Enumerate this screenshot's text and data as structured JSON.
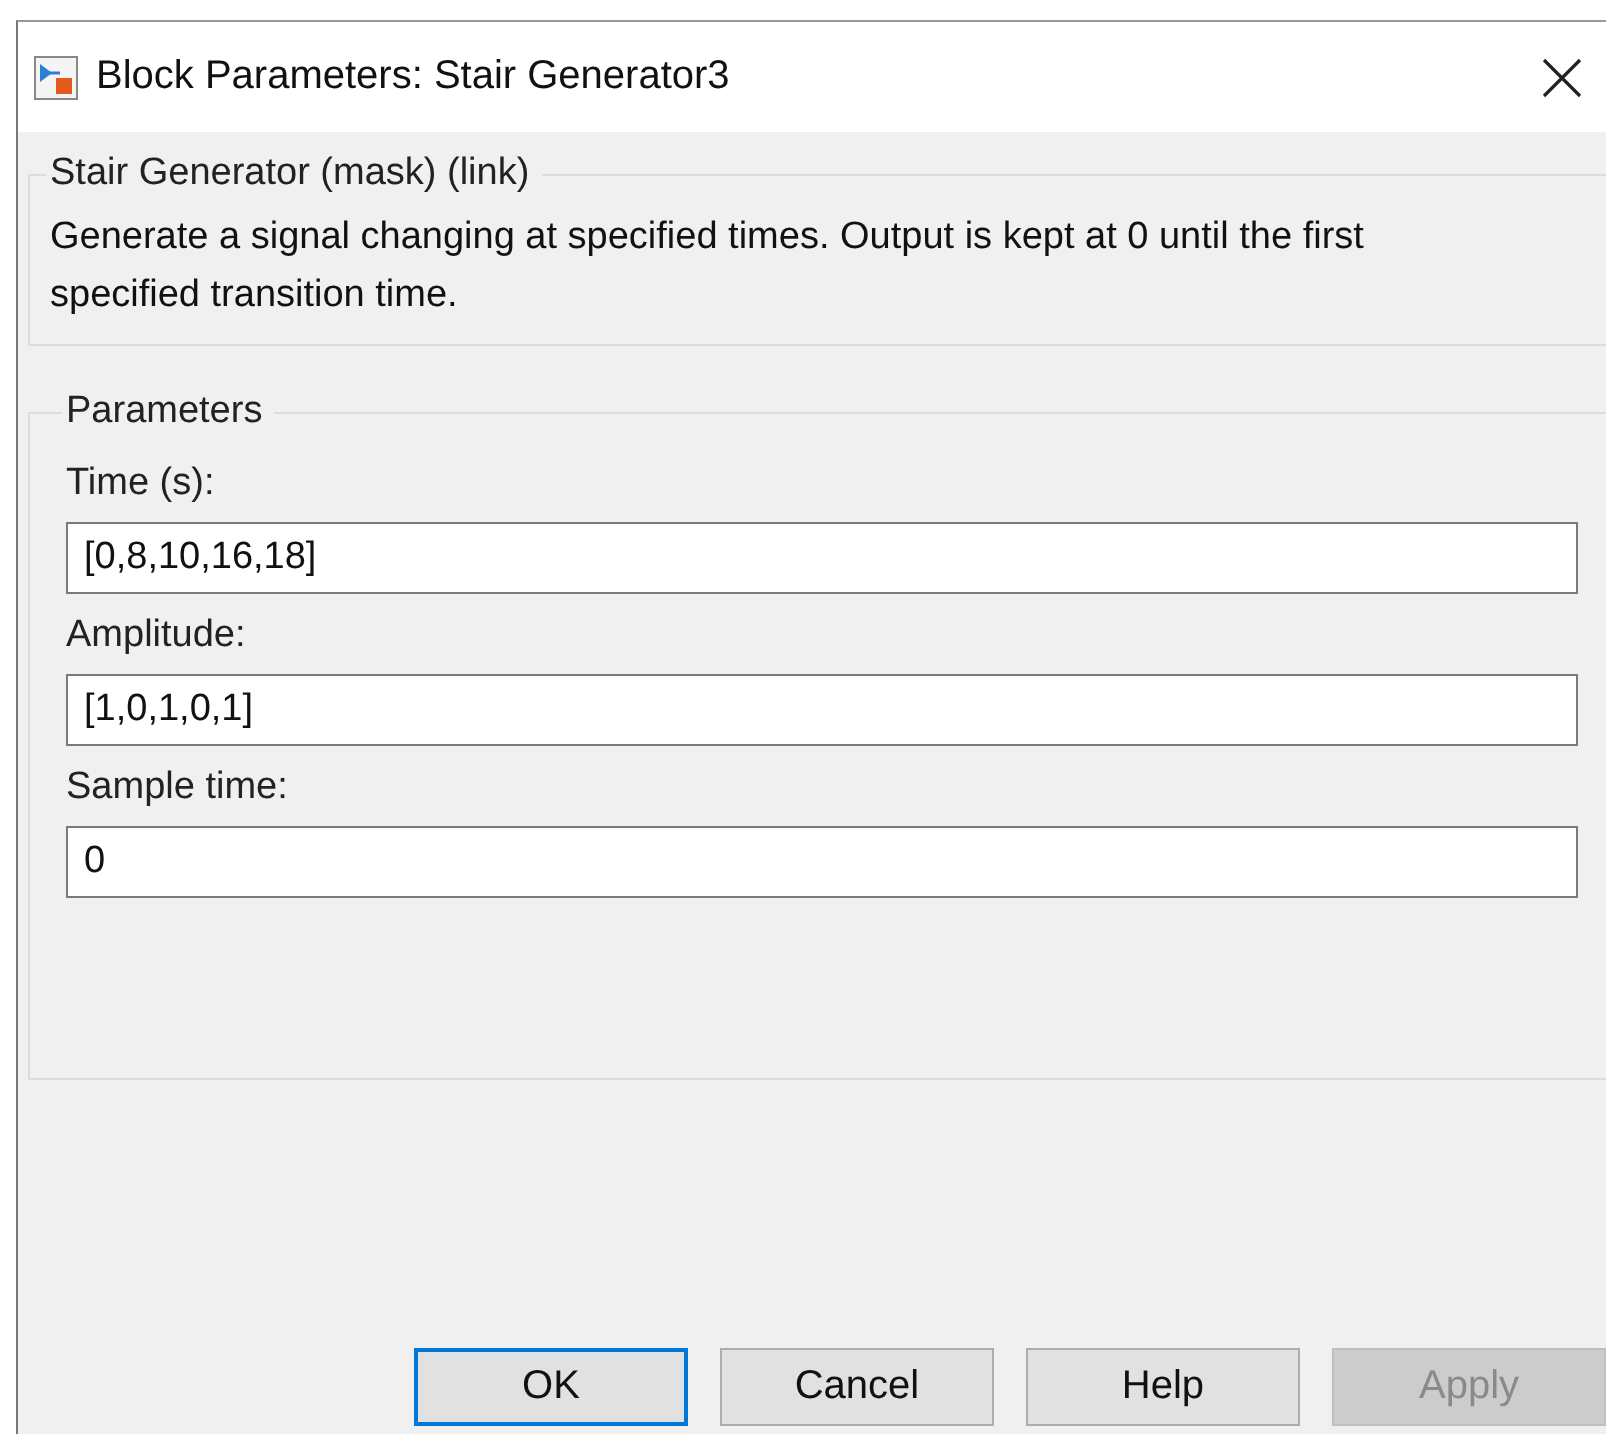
{
  "window": {
    "title": "Block Parameters: Stair Generator3"
  },
  "description_group": {
    "title": "Stair Generator (mask) (link)",
    "text": "Generate a signal changing at specified times. Output is kept at 0 until the first specified transition time."
  },
  "parameters_group": {
    "title": "Parameters",
    "fields": [
      {
        "label": "Time (s):",
        "value": "[0,8,10,16,18]"
      },
      {
        "label": "Amplitude:",
        "value": "[1,0,1,0,1]"
      },
      {
        "label": "Sample time:",
        "value": "0"
      }
    ]
  },
  "buttons": [
    {
      "label": "OK",
      "focused": true,
      "disabled": false
    },
    {
      "label": "Cancel",
      "focused": false,
      "disabled": false
    },
    {
      "label": "Help",
      "focused": false,
      "disabled": false
    },
    {
      "label": "Apply",
      "focused": false,
      "disabled": true
    }
  ]
}
